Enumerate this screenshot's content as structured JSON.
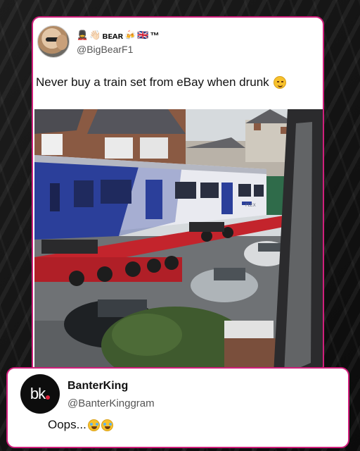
{
  "tweet": {
    "display_name": "ʙᴇᴀʀ",
    "name_emojis_before": [
      "💂",
      "👋🏻"
    ],
    "name_emojis_after": [
      "🍻",
      "🇬🇧"
    ],
    "name_suffix": "™",
    "handle": "@BigBearF1",
    "text": "Never buy a train set from eBay when drunk",
    "text_emoji": "smiling-face-emoji",
    "photo": {
      "train_sign": "FLEX",
      "colors": {
        "train_blue": "#2b3f9a",
        "train_white": "#e9eaf0",
        "trailer_red": "#c3242c",
        "sky": "#d8dcdf"
      }
    }
  },
  "reply": {
    "avatar_text": "bk",
    "name": "BanterKing",
    "handle": "@BanterKinggram",
    "text": "Oops...",
    "emojis": [
      "laughing-tears-emoji",
      "laughing-tears-emoji"
    ]
  },
  "colors": {
    "card_border": "#d01f7c",
    "background": "#141414"
  }
}
